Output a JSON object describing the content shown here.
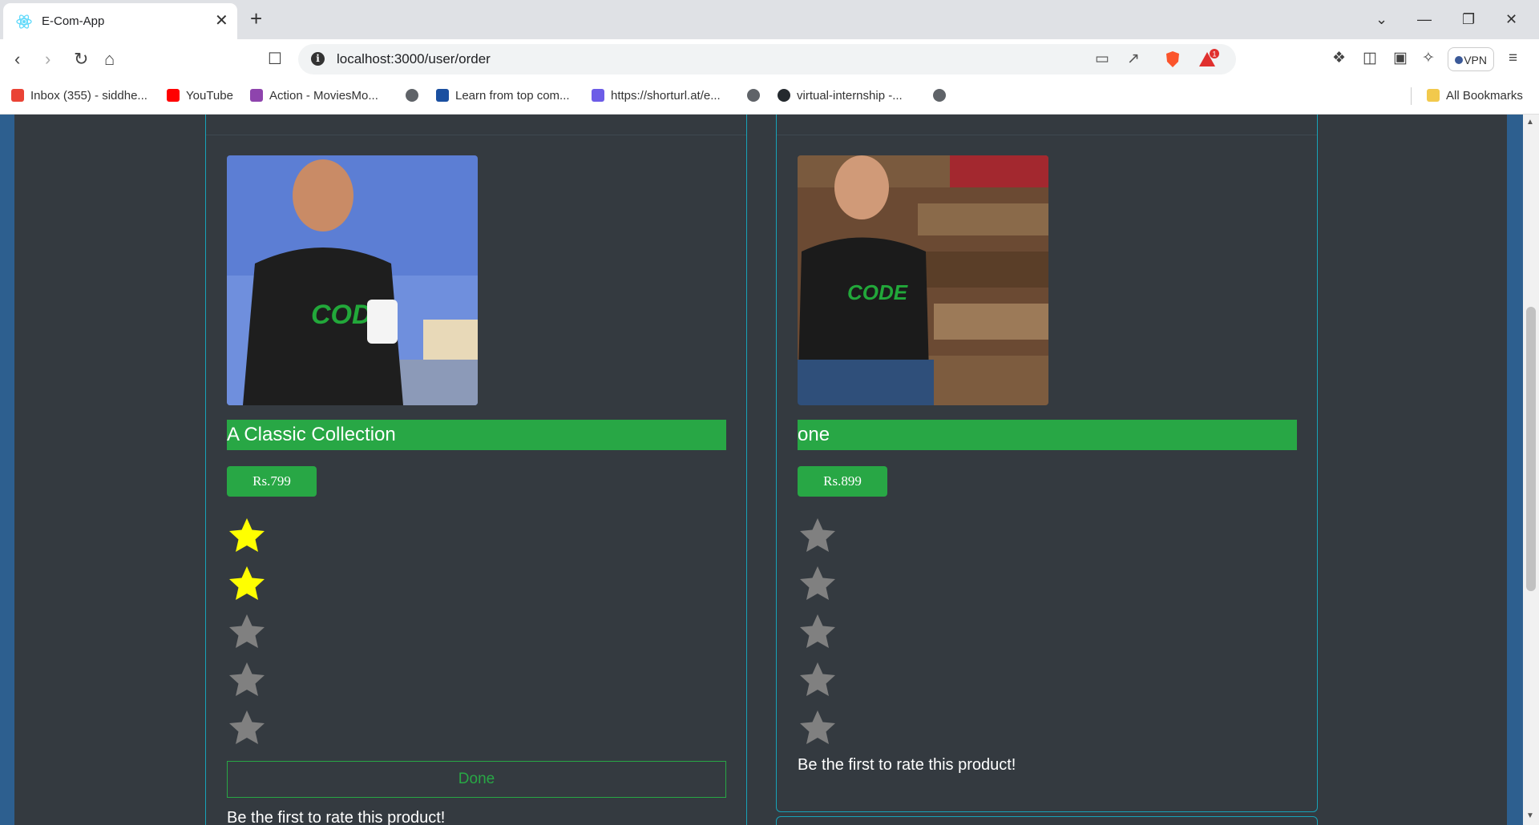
{
  "browser": {
    "tab_title": "E-Com-App",
    "tab_close": "✕",
    "new_tab": "+",
    "window_controls": [
      "⌄",
      "—",
      "❐",
      "✕"
    ],
    "url": "localhost:3000/user/order",
    "vpn_label": "VPN",
    "badge_count": "1",
    "bookmarks": [
      {
        "label": "Inbox (355) - siddhe...",
        "icon": "gmail-icon",
        "color": "#ea4335"
      },
      {
        "label": "YouTube",
        "icon": "youtube-icon",
        "color": "#ff0000"
      },
      {
        "label": "Action - MoviesMo...",
        "icon": "moviesmod-icon",
        "color": "#8e44ad"
      },
      {
        "label": "Learn from top com...",
        "icon": "learn-icon",
        "color": "#1a4fa0"
      },
      {
        "label": "https://shorturl.at/e...",
        "icon": "shorturl-icon",
        "color": "#6c5ce7"
      },
      {
        "label": "virtual-internship -...",
        "icon": "github-icon",
        "color": "#24292e"
      }
    ],
    "all_bookmarks": "All Bookmarks"
  },
  "orders": [
    {
      "title": "A Classic Collection",
      "price": "Rs.799",
      "rating_filled": 2,
      "rating_max": 5,
      "button": "Done",
      "rate_text": "Be the first to rate this product!"
    },
    {
      "title": "one",
      "price": "Rs.899",
      "rating_filled": 0,
      "rating_max": 5,
      "rate_text": "Be the first to rate this product!"
    }
  ],
  "colors": {
    "accent": "#28a745",
    "card_border": "#17a2b8",
    "background": "#343a40",
    "star_filled": "#ffff00",
    "star_empty": "#808080"
  }
}
